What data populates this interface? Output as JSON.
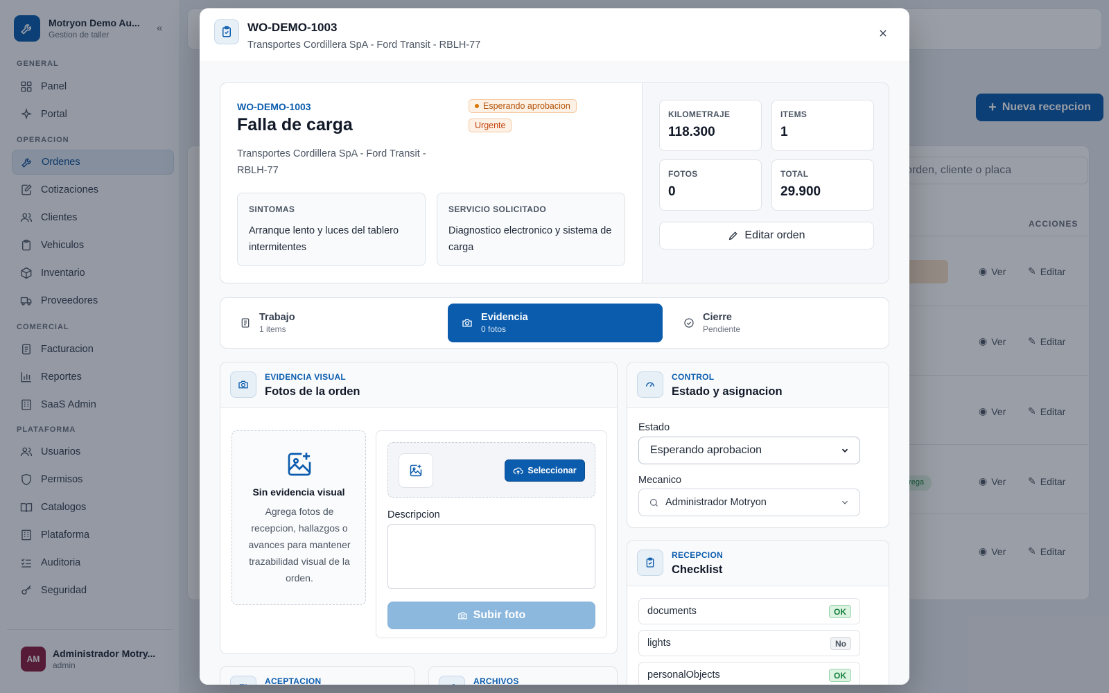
{
  "app": {
    "name": "Motryon Demo Au...",
    "subtitle": "Gestion de taller",
    "nav_groups": [
      "GENERAL",
      "OPERACION",
      "COMERCIAL",
      "PLATAFORMA"
    ],
    "nav": [
      {
        "label": "Panel",
        "icon": "grid-icon"
      },
      {
        "label": "Portal",
        "icon": "sparkle-icon"
      },
      {
        "label": "Ordenes",
        "icon": "wrench-icon",
        "active": true
      },
      {
        "label": "Cotizaciones",
        "icon": "edit-document-icon"
      },
      {
        "label": "Clientes",
        "icon": "users-icon"
      },
      {
        "label": "Vehiculos",
        "icon": "clipboard-icon"
      },
      {
        "label": "Inventario",
        "icon": "box-icon"
      },
      {
        "label": "Proveedores",
        "icon": "truck-icon"
      },
      {
        "label": "Facturacion",
        "icon": "receipt-icon"
      },
      {
        "label": "Reportes",
        "icon": "bar-chart-icon"
      },
      {
        "label": "SaaS Admin",
        "icon": "building-icon"
      },
      {
        "label": "Usuarios",
        "icon": "users-icon"
      },
      {
        "label": "Permisos",
        "icon": "shield-icon"
      },
      {
        "label": "Catalogos",
        "icon": "book-icon"
      },
      {
        "label": "Plataforma",
        "icon": "building-icon"
      },
      {
        "label": "Auditoria",
        "icon": "list-check-icon"
      },
      {
        "label": "Seguridad",
        "icon": "key-icon"
      }
    ],
    "user": {
      "initials": "AM",
      "name": "Administrador Motry...",
      "role": "admin"
    },
    "new_button": "Nueva recepcion",
    "search_placeholder": "orden, cliente o placa",
    "actions_header": "ACCIONES",
    "view_label": "Ver",
    "edit_label": "Editar",
    "status_chip_fragment": "trega"
  },
  "modal": {
    "title": "WO-DEMO-1003",
    "subtitle": "Transportes Cordillera SpA - Ford Transit - RBLH-77",
    "order": {
      "code": "WO-DEMO-1003",
      "title": "Falla de carga",
      "client": "Transportes Cordillera SpA - Ford Transit - RBLH-77",
      "status_badge": "Esperando aprobacion",
      "priority_badge": "Urgente",
      "symptoms_label": "SINTOMAS",
      "symptoms": "Arranque lento y luces del tablero intermitentes",
      "service_label": "SERVICIO SOLICITADO",
      "service": "Diagnostico electronico y sistema de carga"
    },
    "stats": [
      {
        "label": "KILOMETRAJE",
        "value": "118.300"
      },
      {
        "label": "ITEMS",
        "value": "1"
      },
      {
        "label": "FOTOS",
        "value": "0"
      },
      {
        "label": "TOTAL",
        "value": "29.900"
      }
    ],
    "edit_order": "Editar orden",
    "tabs": [
      {
        "label": "Trabajo",
        "sub": "1 items",
        "icon": "document-icon"
      },
      {
        "label": "Evidencia",
        "sub": "0 fotos",
        "icon": "camera-icon",
        "active": true
      },
      {
        "label": "Cierre",
        "sub": "Pendiente",
        "icon": "check-circle-icon"
      }
    ],
    "evidence": {
      "kicker": "EVIDENCIA VISUAL",
      "title": "Fotos de la orden",
      "empty_title": "Sin evidencia visual",
      "empty_text": "Agrega fotos de recepcion, hallazgos o avances para mantener trazabilidad visual de la orden.",
      "select_button": "Seleccionar",
      "description_label": "Descripcion",
      "upload_button": "Subir foto"
    },
    "control": {
      "kicker": "CONTROL",
      "title": "Estado y asignacion",
      "state_label": "Estado",
      "state_value": "Esperando aprobacion",
      "mechanic_label": "Mecanico",
      "mechanic_value": "Administrador Motryon"
    },
    "checklist": {
      "kicker": "RECEPCION",
      "title": "Checklist",
      "items": [
        {
          "label": "documents",
          "status": "OK"
        },
        {
          "label": "lights",
          "status": "No"
        },
        {
          "label": "personalObjects",
          "status": "OK"
        }
      ]
    },
    "lower_cards": [
      {
        "kicker": "ACEPTACION"
      },
      {
        "kicker": "ARCHIVOS"
      }
    ]
  }
}
